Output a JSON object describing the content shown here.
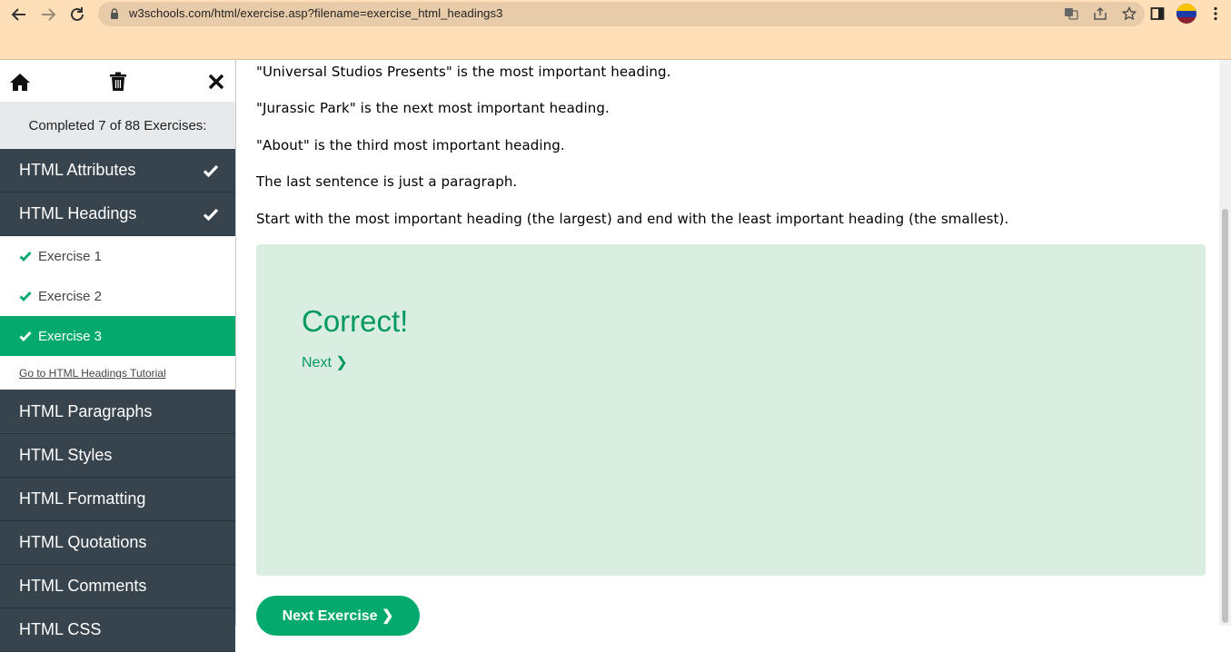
{
  "browser": {
    "url": "w3schools.com/html/exercise.asp?filename=exercise_html_headings3",
    "icons": [
      "back-icon",
      "forward-icon",
      "reload-icon",
      "lock-icon",
      "translate-icon",
      "share-icon",
      "star-icon",
      "sidepanel-icon",
      "profile-avatar",
      "menu-icon"
    ]
  },
  "sidebar": {
    "icons": [
      "home-icon",
      "trash-icon",
      "close-icon"
    ],
    "completed_text": "Completed 7 of 88 Exercises:",
    "categories_top": [
      {
        "label": "HTML Attributes",
        "checked": true
      },
      {
        "label": "HTML Headings",
        "checked": true
      }
    ],
    "exercises": [
      {
        "label": "Exercise 1",
        "active": false
      },
      {
        "label": "Exercise 2",
        "active": false
      },
      {
        "label": "Exercise 3",
        "active": true
      }
    ],
    "tutorial_link": "Go to HTML Headings Tutorial",
    "categories_bottom": [
      {
        "label": "HTML Paragraphs"
      },
      {
        "label": "HTML Styles"
      },
      {
        "label": "HTML Formatting"
      },
      {
        "label": "HTML Quotations"
      },
      {
        "label": "HTML Comments"
      },
      {
        "label": "HTML CSS"
      }
    ]
  },
  "main": {
    "paragraphs": [
      "\"Universal Studios Presents\" is the most important heading.",
      "\"Jurassic Park\" is the next most important heading.",
      "\"About\" is the third most important heading.",
      "The last sentence is just a paragraph.",
      "Start with the most important heading (the largest) and end with the least important heading (the smallest)."
    ],
    "result": {
      "title": "Correct!",
      "next_link": "Next ❯"
    },
    "next_exercise_button": "Next Exercise ❯"
  },
  "colors": {
    "sidebar_dark": "#38444d",
    "accent_green": "#04aa6d",
    "result_bg": "#d9eee1",
    "chrome_bg": "#ffdfb8"
  }
}
